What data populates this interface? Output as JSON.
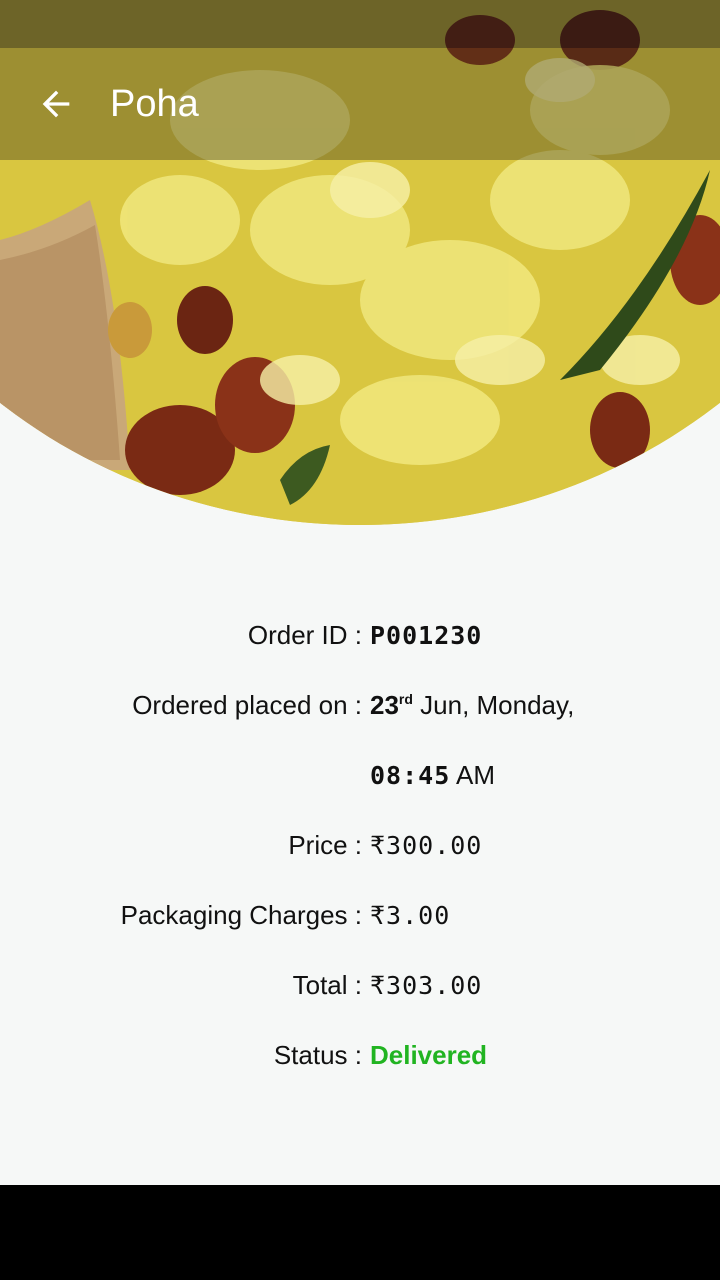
{
  "app_bar": {
    "title": "Poha",
    "back_icon": "arrow-left-icon"
  },
  "hero": {
    "image": "poha-dish-photo"
  },
  "order": {
    "order_id_label": "Order ID :",
    "order_id": "P001230",
    "placed_on_label": "Ordered placed on :",
    "placed_day": "23",
    "placed_day_suffix": "rd",
    "placed_date_rest": " Jun, Monday,",
    "placed_time": "08:45",
    "placed_ampm": " AM",
    "price_label": "Price :",
    "price": "₹300.00",
    "packaging_label": "Packaging Charges :",
    "packaging": "₹3.00",
    "total_label": "Total :",
    "total": "₹303.00",
    "status_label": "Status :",
    "status": "Delivered"
  },
  "colors": {
    "status_delivered": "#21b421",
    "background": "#f6f8f7"
  }
}
